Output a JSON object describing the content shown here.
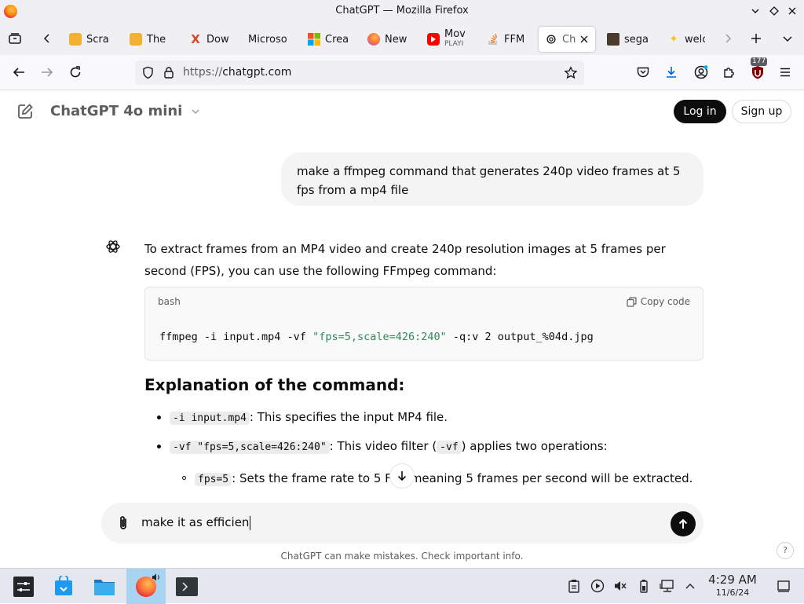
{
  "window": {
    "title": "ChatGPT — Mozilla Firefox"
  },
  "tabs": [
    {
      "label": "Scra",
      "icon": "bookmark-coin-icon",
      "color": "#f2b134"
    },
    {
      "label": "The",
      "icon": "bookmark-coin-icon",
      "color": "#f2b134"
    },
    {
      "label": "Dow",
      "icon": "x-logo-icon",
      "color": "#e0452b"
    },
    {
      "label": "Microso",
      "icon": "",
      "color": ""
    },
    {
      "label": "Crea",
      "icon": "microsoft-logo-icon",
      "color": "#f25022"
    },
    {
      "label": "New",
      "icon": "firefox-icon",
      "color": "#ff7139"
    },
    {
      "label": "Mov",
      "sublabel": "PLAYI",
      "icon": "youtube-icon",
      "color": "#ff0000"
    },
    {
      "label": "FFM",
      "icon": "stackoverflow-icon",
      "color": "#f48024"
    },
    {
      "label": "Ch",
      "icon": "openai-icon",
      "color": "#0d0d0d",
      "active": true
    },
    {
      "label": "sega",
      "icon": "image-thumb-icon",
      "color": "#4a3b2a"
    },
    {
      "label": "welc",
      "icon": "sparkle-icon",
      "color": "#f2c230"
    }
  ],
  "navbar": {
    "url_protocol": "https://",
    "url_host": "chatgpt.com",
    "extension_badge": "177"
  },
  "chat_header": {
    "model": "ChatGPT 4o mini",
    "login_label": "Log in",
    "signup_label": "Sign up"
  },
  "user_message": "make a ffmpeg command that generates 240p video frames at 5 fps from a mp4 file",
  "assistant": {
    "intro": "To extract frames from an MP4 video and create 240p resolution images at 5 frames per second (FPS), you can use the following FFmpeg command:",
    "code": {
      "language": "bash",
      "copy_label": "Copy code",
      "part1": "ffmpeg -i input.mp4 -vf ",
      "string": "\"fps=5,scale=426:240\"",
      "part2": " -q:v 2 output_%04d.jpg"
    },
    "explanation_heading": "Explanation of the command:",
    "bullets": [
      {
        "code": "-i input.mp4",
        "text": ": This specifies the input MP4 file."
      },
      {
        "code": "-vf \"fps=5,scale=426:240\"",
        "text": ": This video filter (",
        "code2": "-vf",
        "text2": ") applies two operations:"
      }
    ],
    "sub_bullet": {
      "code": "fps=5",
      "text": ": Sets the frame rate to 5 F",
      "text_after": "meaning 5 frames per second will be extracted."
    }
  },
  "composer": {
    "value": "make it as efficien"
  },
  "disclaimer": "ChatGPT can make mistakes. Check important info.",
  "help_label": "?",
  "taskbar": {
    "time": "4:29 AM",
    "date": "11/6/24"
  },
  "colors": {
    "brand_black": "#0d0d0d",
    "code_string": "#2e8b57",
    "composer_bg": "#f4f4f4"
  }
}
